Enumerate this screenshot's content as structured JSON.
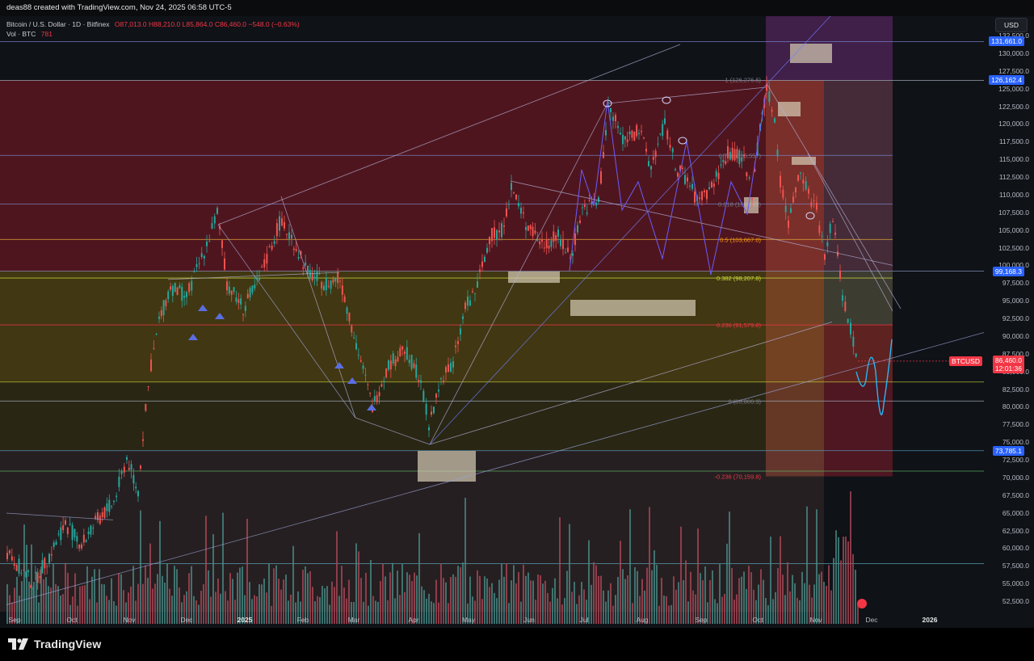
{
  "header": {
    "publisher_line": "deas88 created with TradingView.com, Nov 24, 2025 06:58 UTC-5"
  },
  "legend": {
    "symbol": "Bitcoin / U.S. Dollar · 1D · Bitfinex",
    "open": "O87,013.0",
    "high": "H88,210.0",
    "low": "L85,864.0",
    "close": "C86,460.0",
    "change": "−548.0 (−0.63%)",
    "vol_label": "Vol · BTC",
    "vol_value": "781"
  },
  "currency_button": "USD",
  "price_axis": {
    "ticks": [
      "132,500.0",
      "130,000.0",
      "127,500.0",
      "125,000.0",
      "122,500.0",
      "120,000.0",
      "117,500.0",
      "115,000.0",
      "112,500.0",
      "110,000.0",
      "107,500.0",
      "105,000.0",
      "102,500.0",
      "100,000.0",
      "97,500.0",
      "95,000.0",
      "92,500.0",
      "90,000.0",
      "87,500.0",
      "85,000.0",
      "82,500.0",
      "80,000.0",
      "77,500.0",
      "75,000.0",
      "72,500.0",
      "70,000.0",
      "67,500.0",
      "65,000.0",
      "62,500.0",
      "60,000.0",
      "57,500.0",
      "55,000.0",
      "52,500.0"
    ],
    "labels": [
      {
        "text": "131,661.0",
        "color": "#2962ff"
      },
      {
        "text": "126,162.4",
        "color": "#2962ff"
      },
      {
        "text": "99,168.3",
        "color": "#2962ff"
      },
      {
        "text": "73,785.1",
        "color": "#2962ff"
      }
    ],
    "current_price": {
      "symbol": "BTCUSD",
      "price": "86,460.0",
      "countdown": "12:01:36",
      "color": "#f23645"
    }
  },
  "time_axis": {
    "labels": [
      {
        "text": "Sep",
        "bold": false
      },
      {
        "text": "Oct",
        "bold": false
      },
      {
        "text": "Nov",
        "bold": false
      },
      {
        "text": "Dec",
        "bold": false
      },
      {
        "text": "2025",
        "bold": true
      },
      {
        "text": "Feb",
        "bold": false
      },
      {
        "text": "Mar",
        "bold": false
      },
      {
        "text": "Apr",
        "bold": false
      },
      {
        "text": "May",
        "bold": false
      },
      {
        "text": "Jun",
        "bold": false
      },
      {
        "text": "Jul",
        "bold": false
      },
      {
        "text": "Aug",
        "bold": false
      },
      {
        "text": "Sep",
        "bold": false
      },
      {
        "text": "Oct",
        "bold": false
      },
      {
        "text": "Nov",
        "bold": false
      },
      {
        "text": "Dec",
        "bold": false
      },
      {
        "text": "2026",
        "bold": true
      }
    ]
  },
  "fib_levels": [
    {
      "label": "1 (126,276.5)",
      "color": "#787b86"
    },
    {
      "label": "0.786 (115,557)",
      "color": "#787b86"
    },
    {
      "label": "0.618 (108,683)",
      "color": "#787b86"
    },
    {
      "label": "0.5 (103,667.0)",
      "color": "#ff9800"
    },
    {
      "label": "0.382 (98,207.8)",
      "color": "#cddc39"
    },
    {
      "label": "0.236 (91,579.8)",
      "color": "#f23645"
    },
    {
      "label": "0 (80,806.3)",
      "color": "#787b86"
    },
    {
      "label": "-0.236 (70,159.8)",
      "color": "#f23645"
    }
  ],
  "footer": {
    "logo_text": "TradingView"
  }
}
